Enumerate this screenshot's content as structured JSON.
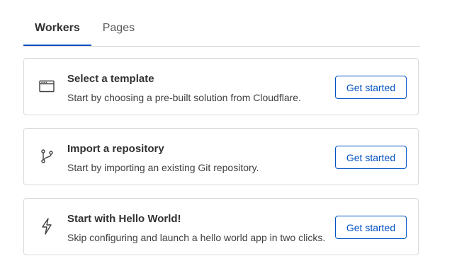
{
  "tabs": [
    {
      "label": "Workers",
      "active": true
    },
    {
      "label": "Pages",
      "active": false
    }
  ],
  "cards": [
    {
      "icon": "browser-window-icon",
      "title": "Select a template",
      "description": "Start by choosing a pre-built solution from Cloudflare.",
      "button_label": "Get started"
    },
    {
      "icon": "git-branch-icon",
      "title": "Import a repository",
      "description": "Start by importing an existing Git repository.",
      "button_label": "Get started"
    },
    {
      "icon": "lightning-bolt-icon",
      "title": "Start with Hello World!",
      "description": "Skip configuring and launch a hello world app in two clicks.",
      "button_label": "Get started"
    }
  ],
  "colors": {
    "accent": "#0051c3",
    "border": "#d9d9d9",
    "text": "#313131"
  }
}
